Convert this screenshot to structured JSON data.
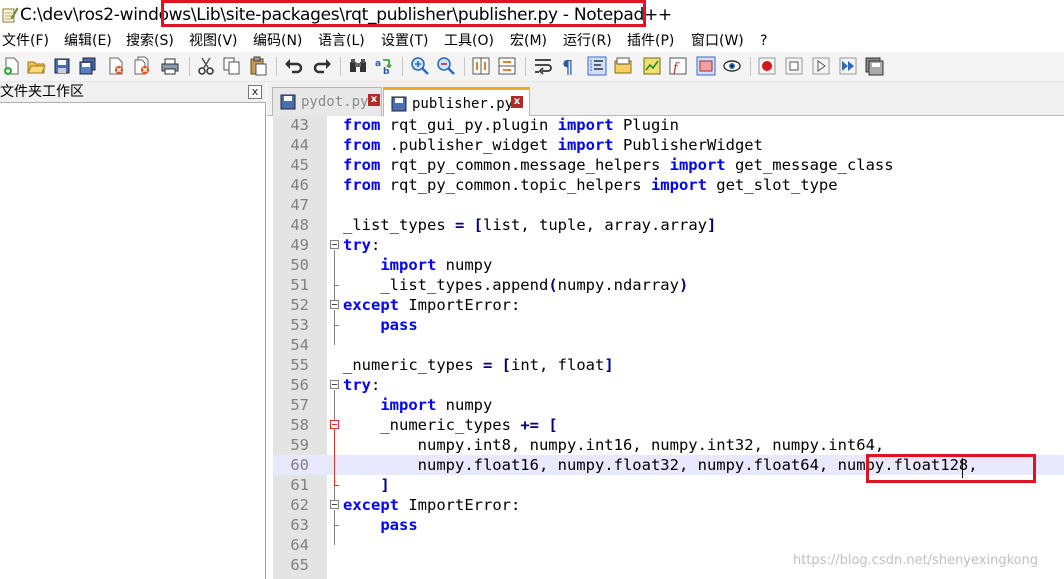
{
  "window": {
    "title": "C:\\dev\\ros2-windows\\Lib\\site-packages\\rqt_publisher\\publisher.py - Notepad++"
  },
  "menu": [
    "文件(F)",
    "编辑(E)",
    "搜索(S)",
    "视图(V)",
    "编码(N)",
    "语言(L)",
    "设置(T)",
    "工具(O)",
    "宏(M)",
    "运行(R)",
    "插件(P)",
    "窗口(W)",
    "?"
  ],
  "panel": {
    "title": "文件夹工作区",
    "close": "x"
  },
  "tabs": [
    {
      "label": "pydot.py",
      "close": "x",
      "active": false
    },
    {
      "label": "publisher.py",
      "close": "x",
      "active": true
    }
  ],
  "editor": {
    "lines": [
      {
        "n": "43",
        "text": "from rqt_gui_py.plugin import Plugin"
      },
      {
        "n": "44",
        "text": "from .publisher_widget import PublisherWidget"
      },
      {
        "n": "45",
        "text": "from rqt_py_common.message_helpers import get_message_class"
      },
      {
        "n": "46",
        "text": "from rqt_py_common.topic_helpers import get_slot_type"
      },
      {
        "n": "47",
        "text": ""
      },
      {
        "n": "48",
        "text": "_list_types = [list, tuple, array.array]"
      },
      {
        "n": "49",
        "text": "try:"
      },
      {
        "n": "50",
        "text": "    import numpy"
      },
      {
        "n": "51",
        "text": "    _list_types.append(numpy.ndarray)"
      },
      {
        "n": "52",
        "text": "except ImportError:"
      },
      {
        "n": "53",
        "text": "    pass"
      },
      {
        "n": "54",
        "text": ""
      },
      {
        "n": "55",
        "text": "_numeric_types = [int, float]"
      },
      {
        "n": "56",
        "text": "try:"
      },
      {
        "n": "57",
        "text": "    import numpy"
      },
      {
        "n": "58",
        "text": "    _numeric_types += ["
      },
      {
        "n": "59",
        "text": "        numpy.int8, numpy.int16, numpy.int32, numpy.int64,"
      },
      {
        "n": "60",
        "text": "        numpy.float16, numpy.float32, numpy.float64, numpy.float128,"
      },
      {
        "n": "61",
        "text": "    ]"
      },
      {
        "n": "62",
        "text": "except ImportError:"
      },
      {
        "n": "63",
        "text": "    pass"
      },
      {
        "n": "64",
        "text": ""
      },
      {
        "n": "65",
        "text": ""
      }
    ],
    "current_line": "60"
  },
  "watermark": "https://blog.csdn.net/shenyexingkong",
  "colors": {
    "keyword": "#0000ff",
    "highlight_box": "#e0141e",
    "current_line": "#e8e8ff",
    "gutter": "#e4e4e4"
  },
  "icons": [
    "new-file-icon",
    "open-file-icon",
    "save-icon",
    "save-all-icon",
    "close-icon",
    "close-all-icon",
    "print-icon",
    "cut-icon",
    "copy-icon",
    "paste-icon",
    "undo-icon",
    "redo-icon",
    "find-icon",
    "replace-icon",
    "zoom-in-icon",
    "zoom-out-icon",
    "sync-vertical-icon",
    "sync-horizontal-icon",
    "word-wrap-icon",
    "show-all-chars-icon",
    "indent-guide-icon",
    "lang-udl-icon",
    "doc-map-icon",
    "function-list-icon",
    "folder-workspace-icon",
    "monitor-icon",
    "record-macro-icon",
    "stop-macro-icon",
    "play-macro-icon",
    "run-macro-multiple-icon",
    "save-macro-icon"
  ]
}
